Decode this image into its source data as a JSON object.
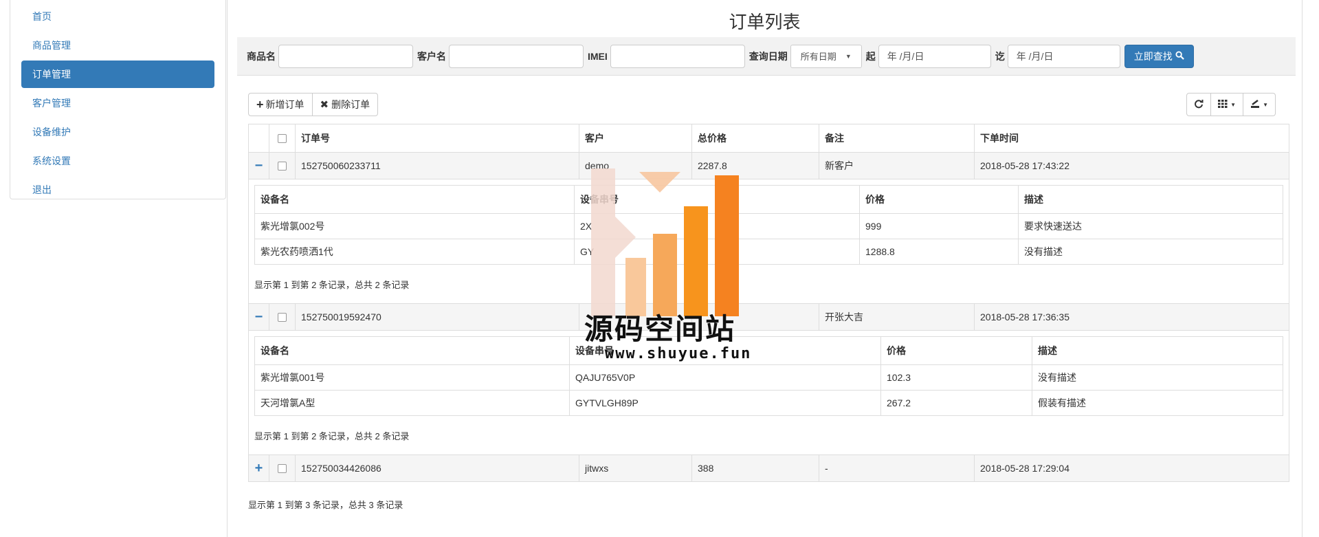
{
  "sidebar": {
    "items": [
      {
        "label": "首页"
      },
      {
        "label": "商品管理"
      },
      {
        "label": "订单管理"
      },
      {
        "label": "客户管理"
      },
      {
        "label": "设备维护"
      },
      {
        "label": "系统设置"
      },
      {
        "label": "退出"
      }
    ]
  },
  "page_title": "订单列表",
  "search": {
    "product_label": "商品名",
    "customer_label": "客户名",
    "imei_label": "IMEI",
    "date_label": "查询日期",
    "date_select_value": "所有日期",
    "from_label": "起",
    "from_placeholder": "年 /月/日",
    "to_label": "讫",
    "to_placeholder": "年 /月/日",
    "submit_label": "立即查找"
  },
  "toolbar": {
    "add_label": "新增订单",
    "delete_label": "删除订单"
  },
  "table": {
    "headers": [
      "订单号",
      "客户",
      "总价格",
      "备注",
      "下单时间"
    ],
    "detail_headers": [
      "设备名",
      "设备串号",
      "价格",
      "描述"
    ],
    "orders": [
      {
        "toggle": "−",
        "id": "152750060233711",
        "customer": "demo",
        "total": "2287.8",
        "note": "新客户",
        "time": "2018-05-28 17:43:22",
        "items": [
          {
            "name": "紫光增氯002号",
            "serial": "2X",
            "price": "999",
            "desc": "要求快速送达"
          },
          {
            "name": "紫光农药喷洒1代",
            "serial": "GY",
            "price": "1288.8",
            "desc": "没有描述"
          }
        ],
        "pagination": "显示第 1 到第 2 条记录，总共 2 条记录"
      },
      {
        "toggle": "−",
        "id": "152750019592470",
        "customer": "",
        "total": "",
        "note": "开张大吉",
        "time": "2018-05-28 17:36:35",
        "items": [
          {
            "name": "紫光增氯001号",
            "serial": "QAJU765V0P",
            "price": "102.3",
            "desc": "没有描述"
          },
          {
            "name": "天河增氯A型",
            "serial": "GYTVLGH89P",
            "price": "267.2",
            "desc": "假装有描述"
          }
        ],
        "pagination": "显示第 1 到第 2 条记录，总共 2 条记录"
      },
      {
        "toggle": "+",
        "id": "152750034426086",
        "customer": "jitwxs",
        "total": "388",
        "note": "-",
        "time": "2018-05-28 17:29:04"
      }
    ]
  },
  "pagination_main": "显示第 1 到第 3 条记录，总共 3 条记录",
  "watermark": {
    "title": "源码空间站",
    "url": "www.shuyue.fun"
  },
  "colors": {
    "primary": "#337ab7",
    "watermark_orange": "#f7941d"
  }
}
